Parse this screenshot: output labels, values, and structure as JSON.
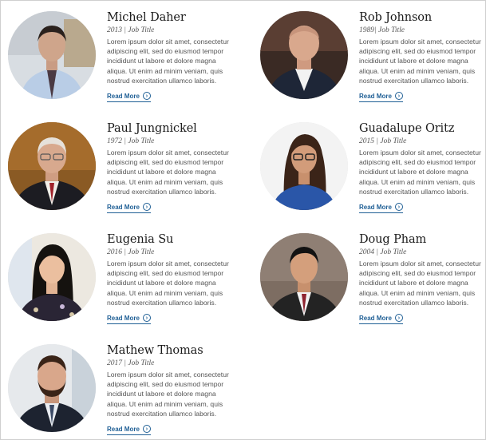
{
  "read_more_label": "Read More",
  "accent_color": "#1f5f95",
  "people": [
    {
      "name": "Michel Daher",
      "year": "2013",
      "separator": " | ",
      "job_title": "Job Title",
      "bio": "Lorem ipsum dolor sit amet, consectetur adipiscing elit, sed do eiusmod tempor incididunt ut labore et dolore magna aliqua. Ut enim ad minim veniam, quis nostrud exercitation ullamco laboris."
    },
    {
      "name": "Rob Johnson",
      "year": "1989",
      "separator": "| ",
      "job_title": "Job Title",
      "bio": "Lorem ipsum dolor sit amet, consectetur adipiscing elit, sed do eiusmod tempor incididunt ut labore et dolore magna aliqua. Ut enim ad minim veniam, quis nostrud exercitation ullamco laboris."
    },
    {
      "name": "Paul Jungnickel",
      "year": "1972",
      "separator": " | ",
      "job_title": "Job Title",
      "bio": "Lorem ipsum dolor sit amet, consectetur adipiscing elit, sed do eiusmod tempor incididunt ut labore et dolore magna aliqua. Ut enim ad minim veniam, quis nostrud exercitation ullamco laboris."
    },
    {
      "name": "Guadalupe Oritz",
      "year": "2015",
      "separator": " | ",
      "job_title": "Job Title",
      "bio": "Lorem ipsum dolor sit amet, consectetur adipiscing elit, sed do eiusmod tempor incididunt ut labore et dolore magna aliqua. Ut enim ad minim veniam, quis nostrud exercitation ullamco laboris."
    },
    {
      "name": "Eugenia Su",
      "year": "2016",
      "separator": " | ",
      "job_title": "Job Title",
      "bio": "Lorem ipsum dolor sit amet, consectetur adipiscing elit, sed do eiusmod tempor incididunt ut labore et dolore magna aliqua. Ut enim ad minim veniam, quis nostrud exercitation ullamco laboris."
    },
    {
      "name": "Doug Pham",
      "year": "2004",
      "separator": " | ",
      "job_title": "Job Title",
      "bio": "Lorem ipsum dolor sit amet, consectetur adipiscing elit, sed do eiusmod tempor incididunt ut labore et dolore magna aliqua. Ut enim ad minim veniam, quis nostrud exercitation ullamco laboris."
    },
    {
      "name": "Mathew Thomas",
      "year": "2017",
      "separator": " | ",
      "job_title": "Job Title",
      "bio": "Lorem ipsum dolor sit amet, consectetur adipiscing elit, sed do eiusmod tempor incididunt ut labore et dolore magna aliqua. Ut enim ad minim veniam, quis nostrud exercitation ullamco laboris."
    }
  ]
}
